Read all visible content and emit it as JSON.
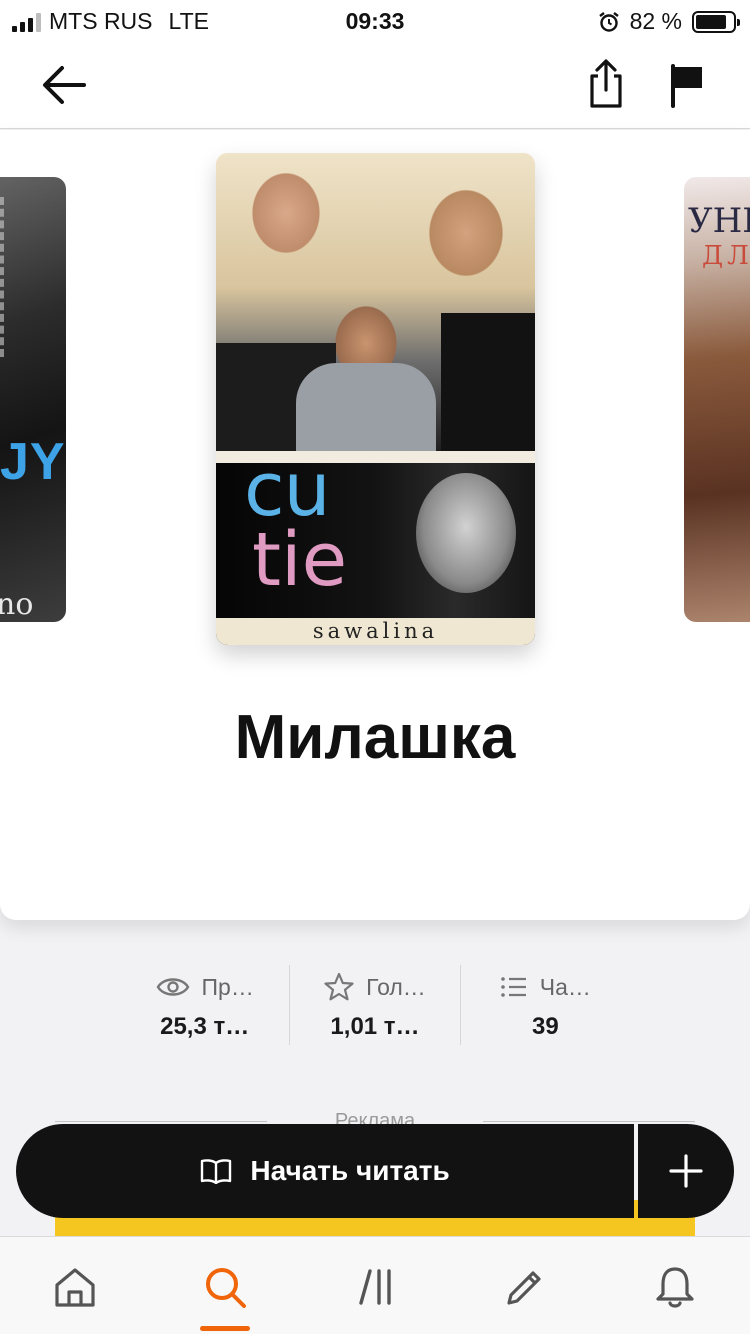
{
  "status_bar": {
    "carrier": "MTS RUS",
    "network": "LTE",
    "time": "09:33",
    "battery_percent": "82 %",
    "battery_level": 0.82,
    "signal_bars": 3
  },
  "nav": {
    "back_icon": "arrow-left-icon",
    "share_icon": "share-icon",
    "report_icon": "flag-icon"
  },
  "carousel": {
    "left_cover_text": "JY",
    "left_cover_caption": "no",
    "main_cover": {
      "line1": "cu",
      "line2": "tie",
      "author_sign": "sawalina"
    },
    "right_cover_text1": "УНИ",
    "right_cover_text2": "ДЛ"
  },
  "book": {
    "title": "Милашка"
  },
  "stats": [
    {
      "icon": "eye-icon",
      "label": "Пр…",
      "value": "25,3 т…"
    },
    {
      "icon": "star-icon",
      "label": "Гол…",
      "value": "1,01 т…"
    },
    {
      "icon": "list-icon",
      "label": "Ча…",
      "value": "39"
    }
  ],
  "ad": {
    "label": "Реклама"
  },
  "actions": {
    "read_label": "Начать читать",
    "read_icon": "book-open-icon",
    "add_icon": "plus-icon"
  },
  "tabbar": {
    "items": [
      {
        "icon": "home-icon"
      },
      {
        "icon": "search-icon",
        "active": true
      },
      {
        "icon": "library-icon"
      },
      {
        "icon": "pencil-icon"
      },
      {
        "icon": "bell-icon"
      }
    ],
    "accent": "#f0640a"
  }
}
